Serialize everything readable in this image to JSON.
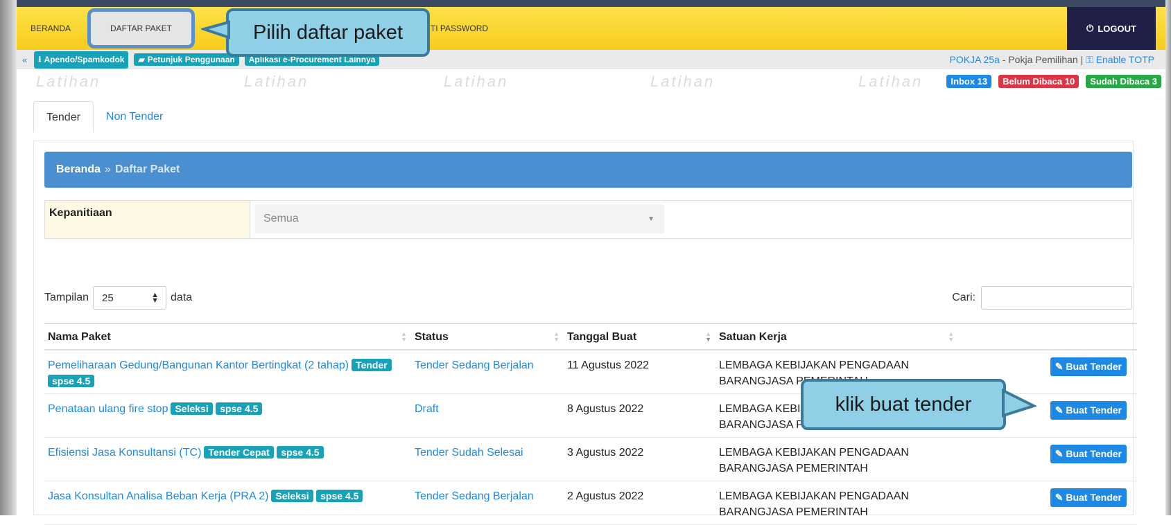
{
  "nav": {
    "items": [
      "BERANDA",
      "DAFTAR PAKET",
      "GANTI PASSWORD"
    ],
    "logout_label": "LOGOUT"
  },
  "callouts": {
    "top": "Pilih daftar paket",
    "right": "klik buat tender"
  },
  "subbar": {
    "links": [
      "Apendo/Spamkodok",
      "Petunjuk Penggunaan",
      "Aplikasi e-Procurement Lainnya"
    ],
    "user_link": "POKJA 25a",
    "user_role": " - Pokja Pemilihan | ",
    "totp_label": "Enable TOTP"
  },
  "badges": {
    "inbox": "Inbox 13",
    "unread": "Belum Dibaca 10",
    "read": "Sudah Dibaca 3",
    "inbox_color": "#1e88e5",
    "unread_color": "#dc3545",
    "read_color": "#28a745"
  },
  "watermark": "Latihan",
  "tabs": [
    "Tender",
    "Non Tender"
  ],
  "breadcrumb": {
    "home": "Beranda",
    "sep": "»",
    "current": "Daftar Paket"
  },
  "filter": {
    "label": "Kepanitiaan",
    "value": "Semua"
  },
  "table_controls": {
    "length_prefix": "Tampilan",
    "length_value": "25",
    "length_suffix": "data",
    "search_label": "Cari:"
  },
  "table": {
    "headers": [
      "Nama Paket",
      "Status",
      "Tanggal Buat",
      "Satuan Kerja",
      ""
    ],
    "action_label": "Buat Tender",
    "rows": [
      {
        "name": "Pemeliharaan Gedung/Bangunan Kantor Bertingkat (2 tahap)",
        "tags": [
          "Tender",
          "spse 4.5"
        ],
        "status": "Tender Sedang Berjalan",
        "date": "11 Agustus 2022",
        "unit": "LEMBAGA KEBIJAKAN PENGADAAN BARANGJASA PEMERINTAH"
      },
      {
        "name": "Penataan ulang fire stop",
        "tags": [
          "Seleksi",
          "spse 4.5"
        ],
        "status": "Draft",
        "date": "8 Agustus 2022",
        "unit": "LEMBAGA KEBIJAKAN PENGADAAN BARANGJASA PEMERINTAH"
      },
      {
        "name": "Efisiensi Jasa Konsultansi (TC)",
        "tags": [
          "Tender Cepat",
          "spse 4.5"
        ],
        "status": "Tender Sudah Selesai",
        "date": "3 Agustus 2022",
        "unit": "LEMBAGA KEBIJAKAN PENGADAAN BARANGJASA PEMERINTAH"
      },
      {
        "name": "Jasa Konsultan Analisa Beban Kerja (PRA 2)",
        "tags": [
          "Seleksi",
          "spse 4.5"
        ],
        "status": "Tender Sedang Berjalan",
        "date": "2 Agustus 2022",
        "unit": "LEMBAGA KEBIJAKAN PENGADAAN BARANGJASA PEMERINTAH"
      }
    ]
  }
}
